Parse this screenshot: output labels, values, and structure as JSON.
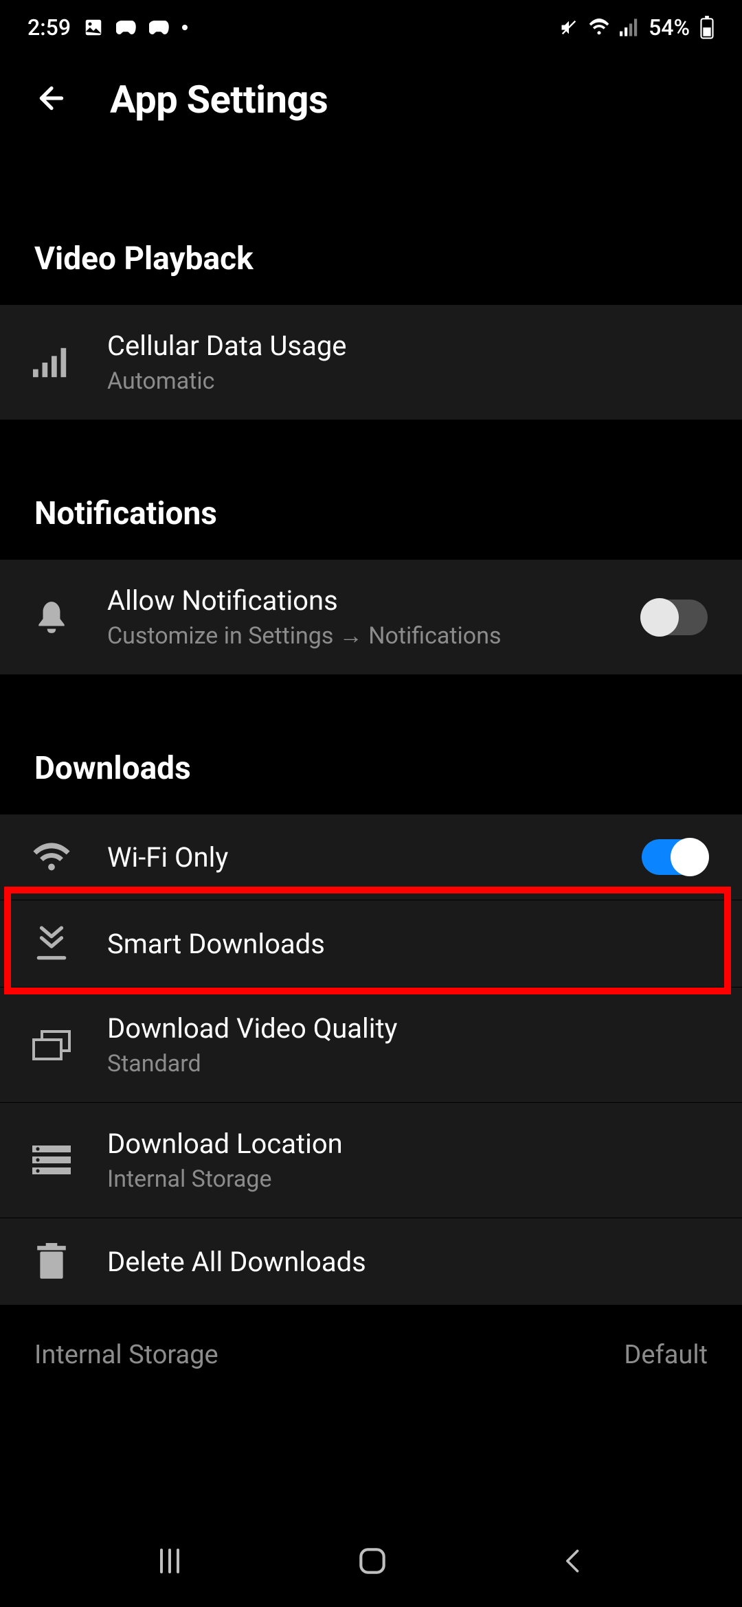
{
  "status": {
    "time": "2:59",
    "battery_text": "54%"
  },
  "header": {
    "title": "App Settings"
  },
  "sections": {
    "video_playback": {
      "header": "Video Playback",
      "cellular": {
        "title": "Cellular Data Usage",
        "sub": "Automatic"
      }
    },
    "notifications": {
      "header": "Notifications",
      "allow": {
        "title": "Allow Notifications",
        "sub": "Customize in Settings → Notifications"
      }
    },
    "downloads": {
      "header": "Downloads",
      "wifi": {
        "title": "Wi-Fi Only"
      },
      "smart": {
        "title": "Smart Downloads"
      },
      "quality": {
        "title": "Download Video Quality",
        "sub": "Standard"
      },
      "location": {
        "title": "Download Location",
        "sub": "Internal Storage"
      },
      "delete": {
        "title": "Delete All Downloads"
      }
    },
    "storage": {
      "label": "Internal Storage",
      "value": "Default"
    }
  }
}
